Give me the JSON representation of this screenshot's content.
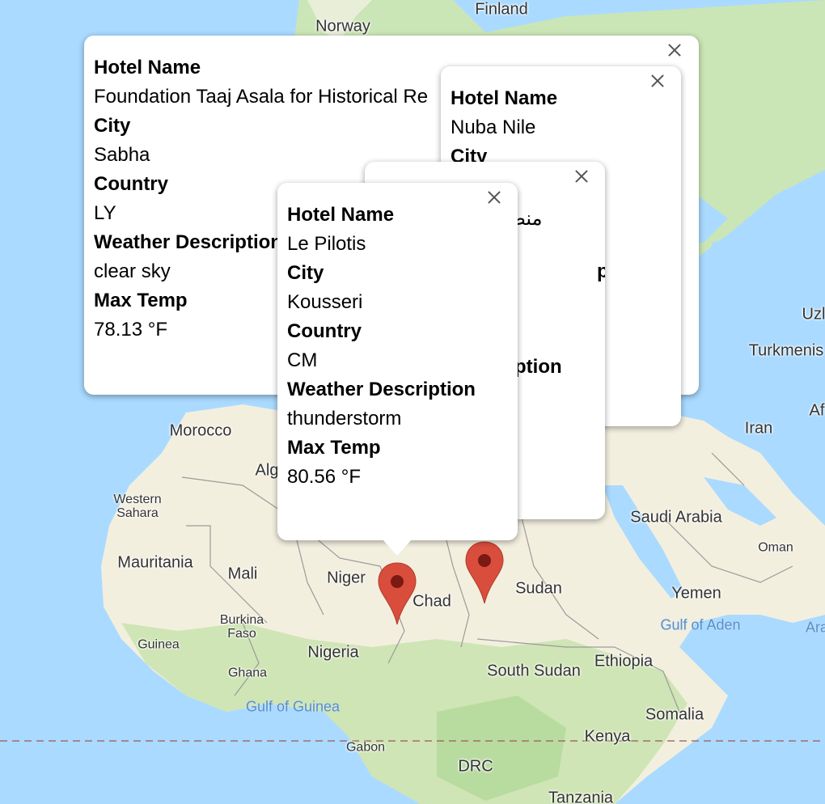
{
  "map": {
    "labels": {
      "finland": "Finland",
      "norway": "Norway",
      "morocco": "Morocco",
      "algeria": "Alg",
      "western_sahara": "Western\nSahara",
      "mauritania": "Mauritania",
      "mali": "Mali",
      "niger": "Niger",
      "chad": "Chad",
      "sudan": "Sudan",
      "burkina_faso": "Burkina\nFaso",
      "guinea": "Guinea",
      "nigeria": "Nigeria",
      "ghana": "Ghana",
      "gulf_of_guinea": "Gulf of Guinea",
      "gabon": "Gabon",
      "drc": "DRC",
      "tanzania": "Tanzania",
      "kenya": "Kenya",
      "somalia": "Somalia",
      "south_sudan": "South Sudan",
      "ethiopia": "Ethiopia",
      "yemen": "Yemen",
      "gulf_of_aden": "Gulf of Aden",
      "saudi_arabia": "Saudi Arabia",
      "oman": "Oman",
      "iran": "Iran",
      "turkmenistan": "Turkmenis",
      "uzbekistan": "Uzl",
      "afghanistan": "Af",
      "arabian_sea": "Ara"
    },
    "colors": {
      "water": "#aadaff",
      "land": "#f5f0e0",
      "green": "#c7e4b0",
      "border": "#9a9a9a",
      "marker": "#d94d3d"
    }
  },
  "popups": [
    {
      "id": "sabha",
      "fields": [
        {
          "label": "Hotel Name",
          "value": "Foundation Taaj Asala for Historical Re"
        },
        {
          "label": "City",
          "value": "Sabha"
        },
        {
          "label": "Country",
          "value": "LY"
        },
        {
          "label": "Weather Description",
          "value": "clear sky"
        },
        {
          "label": "Max Temp",
          "value": "78.13 °F"
        }
      ]
    },
    {
      "id": "nuba",
      "fields": [
        {
          "label": "Hotel Name",
          "value": "Nuba Nile"
        },
        {
          "label": "City",
          "value": ""
        }
      ]
    },
    {
      "id": "third",
      "fragments": [
        "منص",
        "ption",
        "ption"
      ]
    },
    {
      "id": "kousseri",
      "fields": [
        {
          "label": "Hotel Name",
          "value": "Le Pilotis"
        },
        {
          "label": "City",
          "value": "Kousseri"
        },
        {
          "label": "Country",
          "value": "CM"
        },
        {
          "label": "Weather Description",
          "value": "thunderstorm"
        },
        {
          "label": "Max Temp",
          "value": "80.56 °F"
        }
      ]
    }
  ]
}
